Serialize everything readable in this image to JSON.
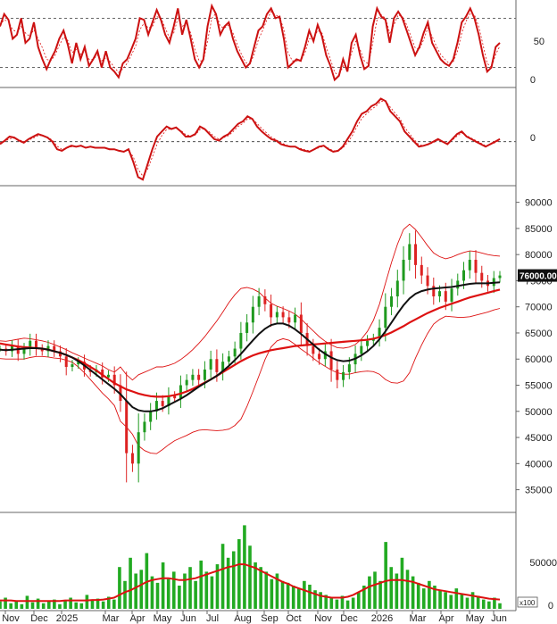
{
  "chart_data": {
    "type": "candlestick",
    "x_labels": [
      "Nov",
      "Dec",
      "2025",
      "Mar",
      "Apr",
      "May",
      "Jun",
      "Jul",
      "Aug",
      "Sep",
      "Oct",
      "Nov",
      "Dec",
      "2026",
      "Mar",
      "Apr",
      "May",
      "Jun"
    ],
    "colors": {
      "up": "#1f9a1f",
      "down": "#dd2222",
      "ma_long": "#dd1111",
      "ma_short": "#111111",
      "band": "#dd1111",
      "volume": "#22aa22",
      "volume_ma": "#dd1111",
      "reference_line": "#333333",
      "price_tag": "#111111"
    },
    "panels": {
      "oscillator": {
        "ticks": [
          "50",
          "0"
        ],
        "range": [
          0,
          100
        ],
        "reference_levels": [
          20,
          80
        ],
        "values": [
          70,
          85,
          78,
          55,
          60,
          80,
          50,
          55,
          75,
          45,
          30,
          18,
          30,
          40,
          55,
          65,
          48,
          25,
          50,
          30,
          45,
          22,
          30,
          40,
          20,
          40,
          20,
          15,
          8,
          25,
          30,
          42,
          55,
          80,
          78,
          60,
          75,
          90,
          78,
          60,
          50,
          70,
          92,
          60,
          78,
          55,
          30,
          20,
          30,
          70,
          95,
          85,
          60,
          70,
          75,
          55,
          40,
          30,
          20,
          25,
          45,
          65,
          70,
          85,
          92,
          80,
          82,
          55,
          20,
          25,
          30,
          28,
          45,
          65,
          52,
          72,
          58,
          35,
          22,
          5,
          10,
          30,
          15,
          50,
          60,
          35,
          18,
          22,
          70,
          92,
          82,
          78,
          50,
          80,
          88,
          80,
          65,
          50,
          35,
          45,
          62,
          75,
          50,
          40,
          30,
          25,
          22,
          30,
          50,
          75,
          82,
          92,
          80,
          60,
          35,
          15,
          20,
          45,
          50
        ],
        "signal": [
          72,
          78,
          76,
          66,
          63,
          70,
          62,
          58,
          66,
          55,
          44,
          30,
          28,
          35,
          47,
          57,
          53,
          38,
          42,
          36,
          40,
          30,
          30,
          35,
          28,
          32,
          27,
          20,
          14,
          18,
          25,
          35,
          46,
          66,
          74,
          68,
          70,
          82,
          80,
          68,
          56,
          62,
          80,
          70,
          74,
          62,
          42,
          28,
          28,
          52,
          80,
          86,
          70,
          68,
          72,
          62,
          48,
          36,
          26,
          24,
          36,
          54,
          65,
          78,
          88,
          84,
          82,
          66,
          38,
          28,
          28,
          28,
          38,
          55,
          55,
          65,
          62,
          45,
          30,
          14,
          10,
          22,
          20,
          38,
          52,
          42,
          28,
          24,
          50,
          78,
          84,
          80,
          62,
          72,
          84,
          82,
          72,
          58,
          44,
          42,
          54,
          68,
          58,
          46,
          36,
          30,
          25,
          27,
          40,
          62,
          76,
          86,
          84,
          70,
          48,
          25,
          20,
          36,
          46
        ]
      },
      "macd": {
        "ticks": [
          "0"
        ],
        "zero_level": 0,
        "range": [
          -80,
          100
        ],
        "values": [
          -5,
          2,
          10,
          8,
          2,
          -2,
          5,
          10,
          15,
          12,
          8,
          0,
          -15,
          -18,
          -12,
          -8,
          -10,
          -8,
          -12,
          -10,
          -12,
          -12,
          -12,
          -15,
          -15,
          -18,
          -20,
          -15,
          -40,
          -70,
          -75,
          -45,
          -15,
          10,
          20,
          30,
          25,
          28,
          20,
          10,
          10,
          15,
          30,
          25,
          15,
          5,
          2,
          10,
          15,
          25,
          35,
          40,
          50,
          45,
          30,
          20,
          12,
          5,
          2,
          -5,
          -8,
          -10,
          -10,
          -15,
          -18,
          -20,
          -15,
          -10,
          -8,
          -15,
          -20,
          -18,
          -10,
          5,
          20,
          40,
          55,
          60,
          70,
          75,
          85,
          80,
          60,
          50,
          40,
          20,
          10,
          0,
          -10,
          -8,
          -5,
          0,
          5,
          0,
          -5,
          5,
          15,
          20,
          10,
          5,
          0,
          -5,
          -10,
          -5,
          0,
          5
        ],
        "signal": [
          -2,
          0,
          6,
          7,
          4,
          0,
          3,
          7,
          12,
          12,
          9,
          3,
          -9,
          -15,
          -13,
          -10,
          -10,
          -9,
          -11,
          -11,
          -11,
          -12,
          -12,
          -14,
          -15,
          -17,
          -19,
          -17,
          -30,
          -55,
          -68,
          -55,
          -30,
          -5,
          12,
          24,
          25,
          27,
          22,
          14,
          11,
          13,
          24,
          25,
          19,
          10,
          5,
          8,
          12,
          20,
          30,
          36,
          45,
          45,
          36,
          26,
          17,
          9,
          4,
          -2,
          -6,
          -9,
          -10,
          -13,
          -16,
          -18,
          -16,
          -12,
          -9,
          -13,
          -18,
          -18,
          -13,
          -2,
          12,
          30,
          46,
          55,
          64,
          70,
          80,
          80,
          68,
          56,
          46,
          28,
          16,
          4,
          -6,
          -8,
          -6,
          -2,
          3,
          1,
          -3,
          3,
          11,
          17,
          12,
          7,
          2,
          -3,
          -8,
          -6,
          -2,
          3
        ]
      },
      "price": {
        "ticks": [
          "90000",
          "85000",
          "80000",
          "75000",
          "70000",
          "65000",
          "60000",
          "55000",
          "50000",
          "45000",
          "40000",
          "35000"
        ],
        "range": [
          31000,
          92500
        ],
        "last_price_label": "76000.00",
        "last_price": 76000,
        "closes": [
          62000,
          61500,
          62500,
          61000,
          62000,
          63500,
          62000,
          61500,
          62500,
          61500,
          60500,
          58500,
          59000,
          59500,
          58000,
          57500,
          58000,
          56500,
          57000,
          55000,
          52000,
          42000,
          40000,
          46000,
          48000,
          50000,
          52000,
          51000,
          53000,
          52500,
          55000,
          56000,
          57000,
          56000,
          58000,
          60000,
          57500,
          59500,
          60500,
          62000,
          65000,
          67000,
          70000,
          72000,
          70500,
          68000,
          69000,
          68000,
          67000,
          68500,
          65000,
          62500,
          61000,
          60000,
          61500,
          58000,
          56000,
          57500,
          59000,
          61000,
          62500,
          63500,
          64000,
          66000,
          70000,
          72000,
          75000,
          79000,
          82000,
          78000,
          76000,
          74000,
          72000,
          73000,
          71000,
          73500,
          75000,
          77000,
          79000,
          76500,
          75000,
          74000,
          75500,
          76000
        ],
        "ma_long": [
          63000,
          62800,
          62600,
          62400,
          62300,
          62200,
          62100,
          62000,
          61800,
          61500,
          61200,
          60800,
          60300,
          59800,
          59200,
          58500,
          57800,
          57000,
          56200,
          55400,
          54800,
          54200,
          53800,
          53400,
          53100,
          52900,
          52800,
          52800,
          52900,
          53100,
          53400,
          53800,
          54300,
          54900,
          55500,
          56100,
          56800,
          57500,
          58200,
          58900,
          59600,
          60200,
          60700,
          61100,
          61400,
          61700,
          61900,
          62100,
          62300,
          62500,
          62600,
          62700,
          62800,
          62900,
          63000,
          63100,
          63200,
          63300,
          63400,
          63500,
          63600,
          63700,
          63900,
          64200,
          64600,
          65100,
          65700,
          66300,
          67000,
          67600,
          68200,
          68800,
          69300,
          69800,
          70200,
          70600,
          71000,
          71400,
          71800,
          72100,
          72400,
          72700,
          73000,
          73300
        ],
        "ma_short": [
          61800,
          61700,
          61800,
          61900,
          62000,
          62100,
          62100,
          62000,
          61800,
          61500,
          61200,
          60800,
          60300,
          59600,
          58800,
          57900,
          57000,
          56100,
          55200,
          54300,
          53300,
          52000,
          50800,
          50200,
          50000,
          50000,
          50200,
          50600,
          51200,
          51800,
          52400,
          53100,
          53900,
          54700,
          55400,
          56100,
          56800,
          57700,
          58700,
          59800,
          61000,
          62300,
          63600,
          64800,
          65800,
          66500,
          66800,
          66800,
          66400,
          65700,
          64800,
          63800,
          62800,
          61800,
          61000,
          60300,
          59800,
          59600,
          59700,
          60100,
          60700,
          61500,
          62500,
          63800,
          65300,
          67000,
          68700,
          70300,
          71600,
          72500,
          73000,
          73300,
          73500,
          73600,
          73700,
          73800,
          74000,
          74200,
          74400,
          74500,
          74500,
          74500,
          74600,
          74700
        ],
        "band_upper": [
          63500,
          63400,
          63600,
          63800,
          64000,
          63900,
          63700,
          63500,
          63200,
          62800,
          62300,
          61800,
          61200,
          60700,
          60200,
          59700,
          59200,
          58700,
          58000,
          57500,
          58500,
          57000,
          56000,
          57000,
          57500,
          58000,
          58500,
          58500,
          58800,
          59200,
          59900,
          60800,
          61800,
          63000,
          64300,
          65800,
          67300,
          69000,
          70800,
          72300,
          73500,
          73700,
          73400,
          72800,
          71700,
          70700,
          70100,
          69700,
          69200,
          68600,
          67700,
          66500,
          65400,
          64300,
          63400,
          62700,
          62200,
          62100,
          62300,
          62800,
          63800,
          65300,
          67400,
          70500,
          74500,
          78500,
          82000,
          84800,
          85800,
          84800,
          83300,
          81700,
          80300,
          79600,
          79200,
          79500,
          80000,
          80400,
          80700,
          80600,
          80300,
          80000,
          79800,
          79700
        ],
        "band_lower": [
          60100,
          60000,
          60000,
          60000,
          60000,
          60300,
          60500,
          60500,
          60400,
          60200,
          60100,
          59800,
          59400,
          58500,
          57400,
          56100,
          54800,
          53500,
          52400,
          51100,
          48100,
          47000,
          45600,
          43400,
          42500,
          42000,
          41900,
          42700,
          43600,
          44400,
          44900,
          45400,
          46000,
          46400,
          46500,
          46400,
          46300,
          46400,
          46600,
          47300,
          48500,
          50900,
          53800,
          56800,
          59900,
          62300,
          63500,
          63900,
          63600,
          62800,
          61900,
          61100,
          60200,
          59300,
          58600,
          57900,
          57400,
          57100,
          57100,
          57400,
          57600,
          57700,
          57600,
          57100,
          56100,
          55500,
          55400,
          55800,
          57400,
          60200,
          62700,
          64900,
          66700,
          67600,
          68200,
          68100,
          68000,
          68000,
          68100,
          68400,
          68700,
          69000,
          69400,
          69700
        ]
      },
      "volume": {
        "ticks": [
          "50000",
          "0"
        ],
        "unit_label": "x100",
        "range": [
          0,
          100000
        ],
        "values": [
          8000,
          12000,
          6000,
          9000,
          5000,
          14000,
          7000,
          11000,
          6000,
          8000,
          10000,
          5000,
          9000,
          12000,
          7000,
          6000,
          15000,
          9000,
          11000,
          8000,
          13000,
          10000,
          45000,
          30000,
          55000,
          38000,
          42000,
          60000,
          35000,
          28000,
          50000,
          32000,
          40000,
          25000,
          38000,
          45000,
          30000,
          52000,
          40000,
          35000,
          48000,
          70000,
          55000,
          62000,
          75000,
          90000,
          68000,
          50000,
          45000,
          40000,
          32000,
          38000,
          30000,
          28000,
          25000,
          22000,
          30000,
          26000,
          20000,
          18000,
          15000,
          12000,
          10000,
          14000,
          9000,
          12000,
          18000,
          25000,
          35000,
          40000,
          30000,
          72000,
          45000,
          38000,
          55000,
          42000,
          35000,
          28000,
          22000,
          30000,
          25000,
          20000,
          18000,
          15000,
          22000,
          16000,
          12000,
          18000,
          14000,
          10000,
          8000,
          12000,
          6000
        ],
        "ma": [
          9000,
          9000,
          9000,
          8500,
          8500,
          8500,
          8500,
          8500,
          8500,
          8500,
          8500,
          8500,
          9000,
          9000,
          9000,
          9000,
          9000,
          9500,
          9500,
          10000,
          11000,
          12000,
          15000,
          18000,
          20000,
          23000,
          26000,
          29000,
          31000,
          32000,
          33000,
          33000,
          32000,
          31000,
          31000,
          32000,
          33000,
          35000,
          37000,
          39000,
          41000,
          43000,
          45000,
          46000,
          48000,
          48000,
          46000,
          44000,
          41000,
          38000,
          35000,
          32000,
          29000,
          27000,
          24000,
          22000,
          20000,
          18000,
          16000,
          14000,
          13000,
          12000,
          12000,
          12000,
          13000,
          15000,
          18000,
          21000,
          24000,
          26000,
          28000,
          30000,
          31000,
          31000,
          31000,
          30000,
          29000,
          27000,
          25000,
          23000,
          21000,
          20000,
          19000,
          18000,
          17000,
          16000,
          15000,
          14000,
          13000,
          12000,
          11000,
          10500,
          10000
        ]
      }
    }
  }
}
